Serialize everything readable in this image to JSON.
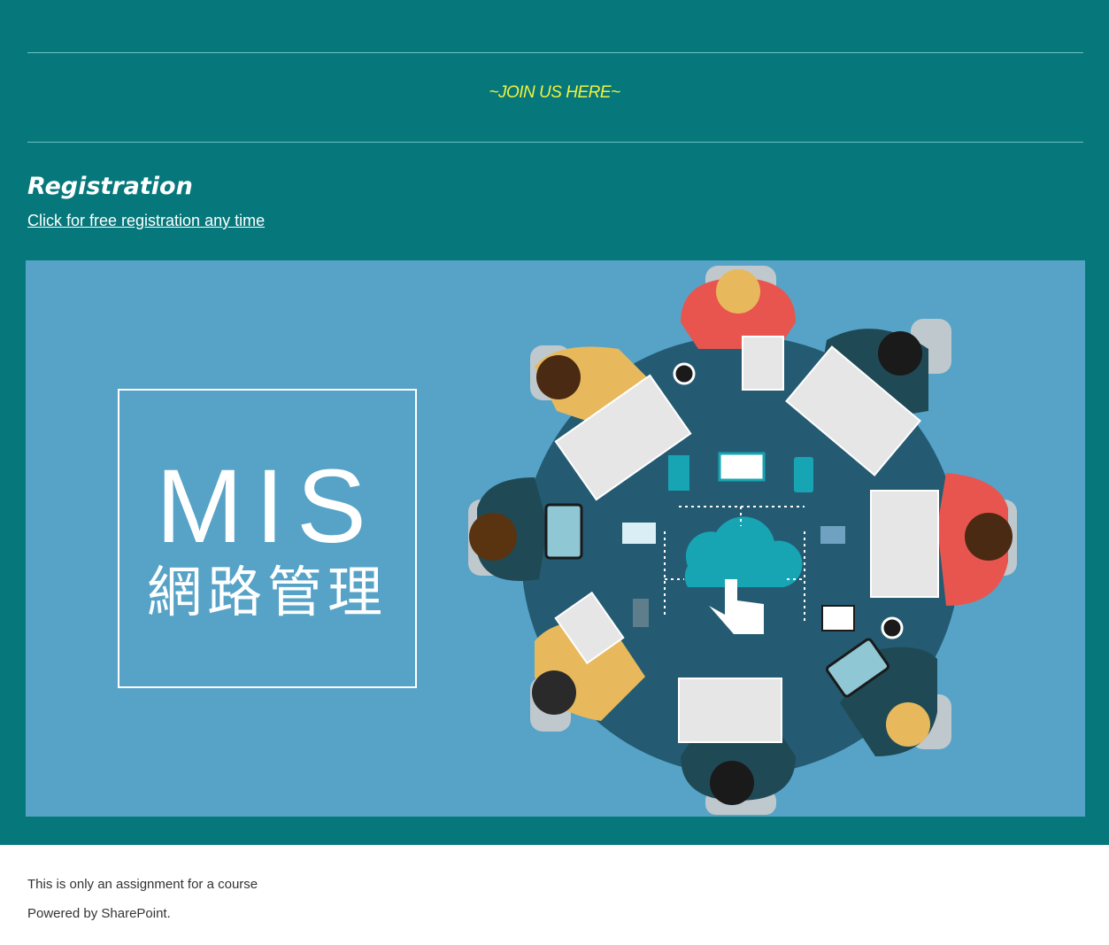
{
  "join_banner": {
    "text": "~JOIN US HERE~"
  },
  "registration": {
    "heading": "Registration",
    "link_text": "Click for free registration any time"
  },
  "hero_image": {
    "title": "MIS",
    "subtitle": "網路管理",
    "background_color": "#56A3C7",
    "table_color": "#245B72"
  },
  "footer": {
    "note": "This is only an assignment for a course",
    "powered_by": "Powered by SharePoint."
  },
  "colors": {
    "page_background": "#06787B",
    "accent_yellow": "#F2F23B",
    "divider": "#6FC1C3"
  }
}
